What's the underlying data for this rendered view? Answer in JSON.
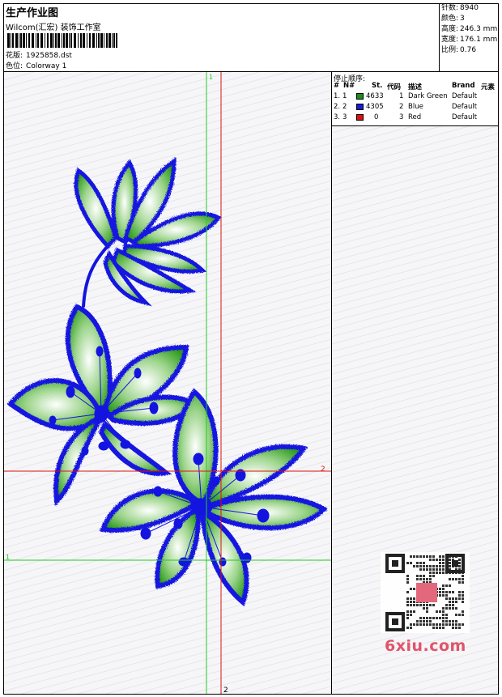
{
  "header": {
    "title": "生产作业图",
    "studio": "Wilcom(汇宏) 装饰工作室",
    "pattern_label": "花版:",
    "pattern_value": "1925858.dst",
    "colorway_label": "色位:",
    "colorway_value": "Colorway 1"
  },
  "stats": [
    {
      "label": "针数:",
      "value": "8940"
    },
    {
      "label": "颜色:",
      "value": "3"
    },
    {
      "label": "高度:",
      "value": "246.3 mm"
    },
    {
      "label": "宽度:",
      "value": "176.1 mm"
    },
    {
      "label": "比例:",
      "value": "0.76"
    }
  ],
  "panel": {
    "stop_title": "停止顺序:",
    "columns": [
      "#",
      "N#",
      "St.",
      "代码",
      "描述",
      "Brand",
      "元素"
    ],
    "rows": [
      {
        "num": "1.",
        "n": "1",
        "color": "#1a8f1a",
        "st": "4633",
        "code": "1",
        "desc": "Dark Green",
        "brand": "Default"
      },
      {
        "num": "2.",
        "n": "2",
        "color": "#1a1adb",
        "st": "4305",
        "code": "2",
        "desc": "Blue",
        "brand": "Default"
      },
      {
        "num": "3.",
        "n": "3",
        "color": "#e01010",
        "st": "0",
        "code": "3",
        "desc": "Red",
        "brand": "Default"
      }
    ]
  },
  "guides": {
    "green_top": "1",
    "green_left": "1",
    "red_right": "2",
    "red_bottom": "2"
  },
  "colors": {
    "green": "#2e9c1c",
    "blue": "#1414e0",
    "red": "#e01010"
  },
  "watermark": "6xiu.com",
  "qr_icon": "qr-code-icon"
}
